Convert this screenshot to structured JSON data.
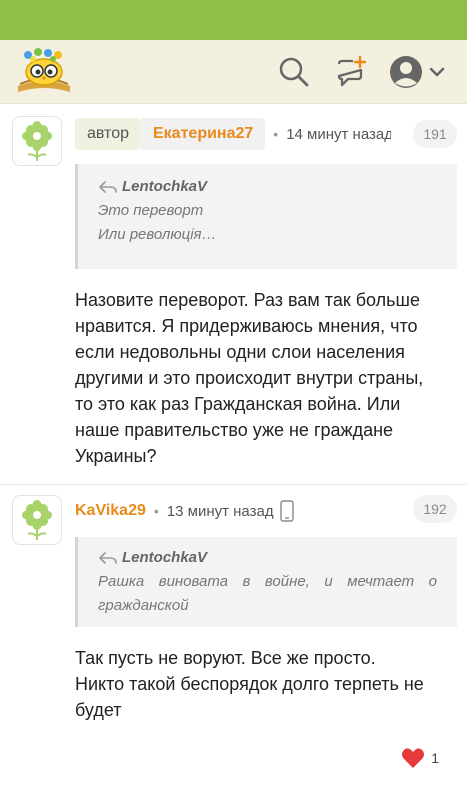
{
  "colors": {
    "status_bar": "#8ebf46",
    "topbar": "#f4f0df",
    "accent_name": "#e98a1b"
  },
  "topbar": {
    "logo_icon": "owl-books-logo-icon",
    "search_icon": "search-icon",
    "new_post_icon": "chat-plus-icon",
    "profile_icon": "user-avatar-icon",
    "dropdown_icon": "chevron-down-icon"
  },
  "comments": [
    {
      "avatar_icon": "flower-avatar-icon",
      "author_label": "автор",
      "name": "Екатерина27",
      "time": "14 минут назад",
      "number": "191",
      "quote": {
        "author": "LentochkaV",
        "lines": [
          "Это переворт",
          "Или революція…"
        ]
      },
      "body_lines": [
        "Назовите переворот. Раз вам так больше",
        "нравится. Я придерживаюсь мнения, что",
        "если недовольны одни слои населения",
        "другими и это происходит внутри страны,",
        "то это как раз Гражданская война. Или",
        "наше правительство уже не граждане",
        "Украины?"
      ]
    },
    {
      "avatar_icon": "flower-avatar-icon",
      "name": "KaVika29",
      "time": "13 минут назад",
      "device_icon": "phone-icon",
      "number": "192",
      "quote": {
        "author": "LentochkaV",
        "lines": [
          "Рашка виновата в войне, и мечтает о",
          "гражданской"
        ]
      },
      "body_lines": [
        "Так пусть не воруют. Все же просто.",
        "Никто такой беспорядок долго терпеть не",
        "будет"
      ],
      "likes": {
        "icon": "heart-icon",
        "count": "1"
      }
    }
  ]
}
